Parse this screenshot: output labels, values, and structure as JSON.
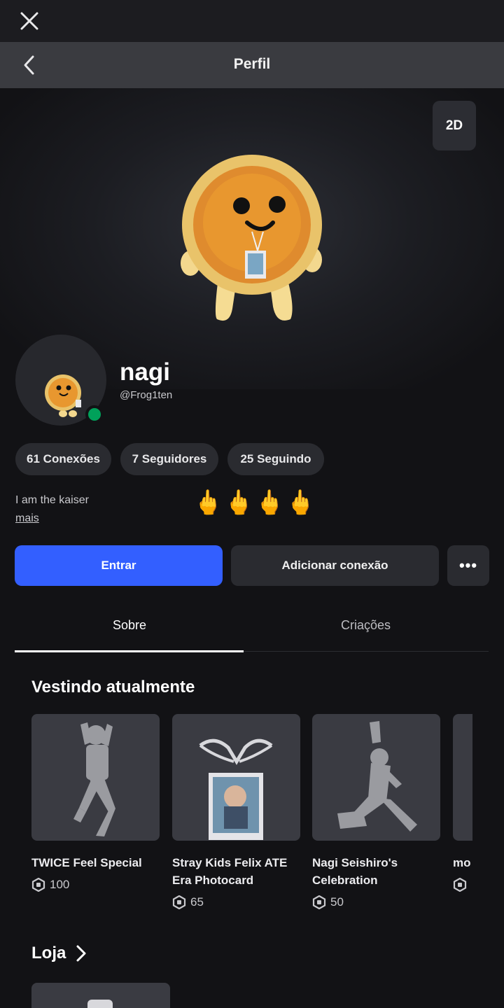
{
  "header": {
    "title": "Perfil"
  },
  "hero": {
    "view_toggle_label": "2D"
  },
  "profile": {
    "display_name": "nagi",
    "username": "@Frog1ten",
    "status_color": "#00a15a",
    "bio": "I am the kaiser",
    "bio_more": "mais",
    "bio_emojis": [
      "🖕",
      "🖕",
      "🖕",
      "🖕"
    ]
  },
  "stats": {
    "connections": "61 Conexões",
    "followers": "7 Seguidores",
    "following": "25 Seguindo"
  },
  "actions": {
    "join_label": "Entrar",
    "add_connection_label": "Adicionar conexão",
    "more_label": "•••"
  },
  "tabs": [
    {
      "label": "Sobre",
      "active": true
    },
    {
      "label": "Criações",
      "active": false
    }
  ],
  "wearing": {
    "title": "Vestindo atualmente",
    "items": [
      {
        "name": "TWICE Feel Special",
        "price": "100",
        "icon": "dance-pose-icon"
      },
      {
        "name": "Stray Kids Felix ATE Era Photocard",
        "price": "65",
        "icon": "photocard-lanyard-icon"
      },
      {
        "name": "Nagi Seishiro's Celebration",
        "price": "50",
        "icon": "celebration-pose-icon"
      },
      {
        "name": "mo",
        "price": "",
        "icon": "item-thumbnail"
      }
    ]
  },
  "shop": {
    "title": "Loja"
  },
  "colors": {
    "accent": "#335fff",
    "background": "#121215",
    "card": "#3a3b42"
  }
}
